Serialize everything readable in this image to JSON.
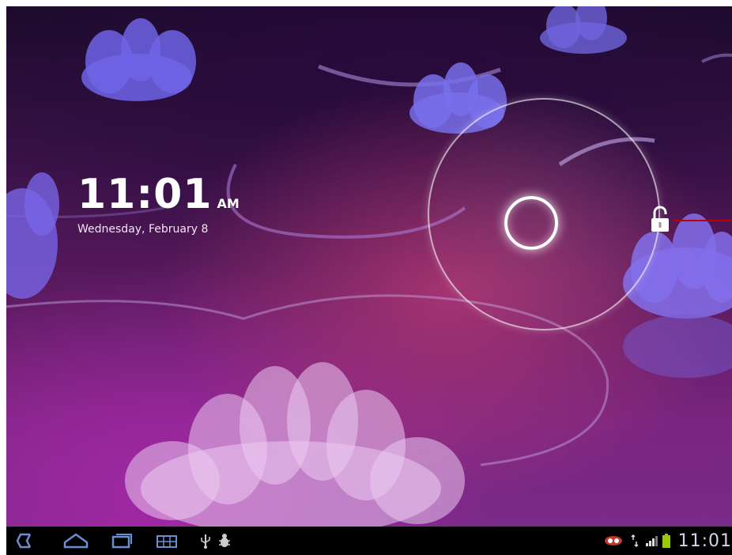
{
  "lockscreen": {
    "time": "11:01",
    "ampm": "AM",
    "date": "Wednesday, February 8"
  },
  "statusbar": {
    "time": "11:01"
  },
  "icons": {
    "back": "back-icon",
    "home": "home-icon",
    "recent_apps": "recent-apps-icon",
    "screenshot": "screenshot-icon",
    "usb": "usb-icon",
    "debug": "usb-debugging-icon",
    "notification": "notification-icon",
    "data": "data-transfer-icon",
    "signal": "signal-icon",
    "battery": "battery-icon",
    "unlock": "unlock-icon"
  },
  "colors": {
    "accent": "#ffffff",
    "unlock_line": "#c00000",
    "status_icon": "#33b5e5",
    "battery": "#99cc00"
  }
}
